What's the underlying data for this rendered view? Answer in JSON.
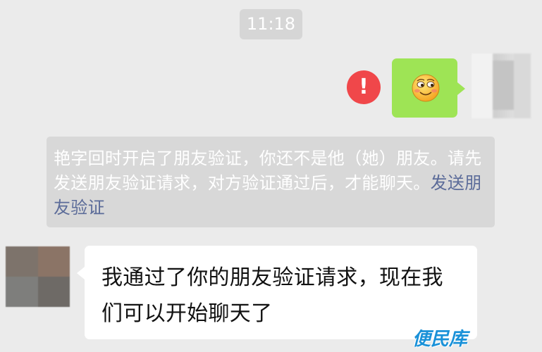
{
  "chat": {
    "time": "11:18",
    "outgoing": {
      "emoji": "smiling-face-emoji",
      "status": "send-failed"
    },
    "system_notice": {
      "text": "艳字回时开启了朋友验证，你还不是他（她）朋友。请先发送朋友验证请求，对方验证通过后，才能聊天。",
      "link": "发送朋友验证"
    },
    "incoming": {
      "text": "我通过了你的朋友验证请求，现在我们可以开始聊天了"
    }
  },
  "watermark": "便民库",
  "colors": {
    "background": "#ebebeb",
    "outgoing_bubble": "#9ee455",
    "error": "#f0474a",
    "link": "#5b6b99",
    "watermark": "#1a91d8"
  }
}
